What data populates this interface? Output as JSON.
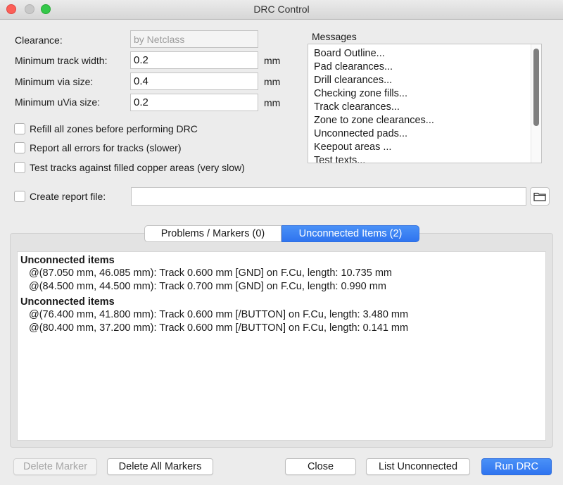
{
  "window": {
    "title": "DRC Control"
  },
  "settings": {
    "clearance_label": "Clearance:",
    "clearance_value": "by Netclass",
    "track_width_label": "Minimum track width:",
    "track_width_value": "0.2",
    "via_size_label": "Minimum via size:",
    "via_size_value": "0.4",
    "uvia_size_label": "Minimum uVia size:",
    "uvia_size_value": "0.2",
    "unit": "mm"
  },
  "options": {
    "refill_zones": "Refill all zones before performing DRC",
    "report_all_errors": "Report all errors for tracks (slower)",
    "test_filled_copper": "Test tracks against filled copper areas (very slow)",
    "create_report": "Create report file:",
    "report_path": ""
  },
  "messages": {
    "title": "Messages",
    "lines": [
      "Board Outline...",
      "Pad clearances...",
      "Drill clearances...",
      "Checking zone fills...",
      "Track clearances...",
      "Zone to zone clearances...",
      "Unconnected pads...",
      "Keepout areas ...",
      "Test texts..."
    ]
  },
  "tabs": {
    "problems": "Problems / Markers (0)",
    "unconnected": "Unconnected Items (2)"
  },
  "results": [
    {
      "heading": "Unconnected items",
      "lines": [
        "@(87.050 mm, 46.085 mm): Track 0.600 mm [GND] on F.Cu, length: 10.735 mm",
        "@(84.500 mm, 44.500 mm): Track 0.700 mm [GND] on F.Cu, length: 0.990 mm"
      ]
    },
    {
      "heading": "Unconnected items",
      "lines": [
        "@(76.400 mm, 41.800 mm): Track 0.600 mm [/BUTTON] on F.Cu, length: 3.480 mm",
        "@(80.400 mm, 37.200 mm): Track 0.600 mm [/BUTTON] on F.Cu, length: 0.141 mm"
      ]
    }
  ],
  "buttons": {
    "delete_marker": "Delete Marker",
    "delete_all_markers": "Delete All Markers",
    "close": "Close",
    "list_unconnected": "List Unconnected",
    "run_drc": "Run DRC"
  },
  "colors": {
    "accent": "#3b82f6",
    "close_light": "#fc5f57",
    "min_light": "#c8c8c8",
    "max_light": "#34c84a"
  }
}
